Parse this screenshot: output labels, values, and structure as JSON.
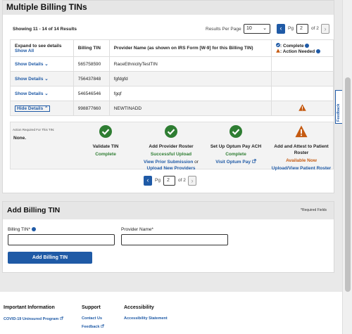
{
  "billing_tins": {
    "title": "Multiple Billing TINs",
    "results_info": "Showing 11 - 14 of 14 Results",
    "results_per_page_label": "Results Per Page",
    "results_per_page_value": "10",
    "pager": {
      "pg_label": "Pg",
      "page_value": "2",
      "of_label": "of 2"
    },
    "table": {
      "headers": {
        "expand": "Expand to see details",
        "show_all": "Show All",
        "billing_tin": "Billing TIN",
        "provider_name": "Provider Name (as shown on IRS Form [W-9] for this Billing TIN)",
        "legend_complete": ": Complete",
        "legend_action": ": Action Needed"
      },
      "rows": [
        {
          "toggle": "Show Details",
          "tin": "565758590",
          "name": "RaceEthnicityTestTIN"
        },
        {
          "toggle": "Show Details",
          "tin": "756437848",
          "name": "fgfdgfd"
        },
        {
          "toggle": "Show Details",
          "tin": "546546546",
          "name": "fgqf"
        },
        {
          "toggle": "Hide Details",
          "tin": "998877660",
          "name": "NEWTINADD"
        }
      ]
    },
    "details": {
      "action_label": "Action Required For This TIN:",
      "none": "None.",
      "steps": [
        {
          "title": "Validate TIN",
          "status": "Complete"
        },
        {
          "title": "Add Provider Roster",
          "status": "Successful Upload",
          "link1": "View Prior Submission",
          "link_joiner": "or",
          "link2": "Upload New Providers"
        },
        {
          "title": "Set Up Optum Pay ACH",
          "status": "Complete",
          "link1": "Visit Optum Pay"
        },
        {
          "title": "Add and Attest to Patient Roster",
          "status": "Available Now",
          "link1": "Upload/View Patient Roster"
        }
      ]
    }
  },
  "add_tin": {
    "title": "Add Billing TIN",
    "required_note": "*Required Fields",
    "billing_tin_label": "Billing TIN*",
    "provider_name_label": "Provider Name*",
    "button": "Add Billing TIN"
  },
  "footer": {
    "col1": {
      "title": "Important Information",
      "links": [
        "COVID-19 Uninsured Program"
      ]
    },
    "col2": {
      "title": "Support",
      "links": [
        "Contact Us",
        "Feedback"
      ]
    },
    "col3": {
      "title": "Accessibility",
      "links": [
        "Accessibility Statement"
      ]
    }
  },
  "feedback_tab": "Feedback",
  "colors": {
    "primary": "#1f5aa6",
    "success": "#2e7d32",
    "warning": "#c55a11"
  },
  "icons": [
    "chevron-down-icon",
    "chevron-up-icon",
    "chevron-left-icon",
    "chevron-right-icon",
    "check-circle-icon",
    "warning-triangle-icon",
    "info-icon",
    "external-link-icon"
  ]
}
